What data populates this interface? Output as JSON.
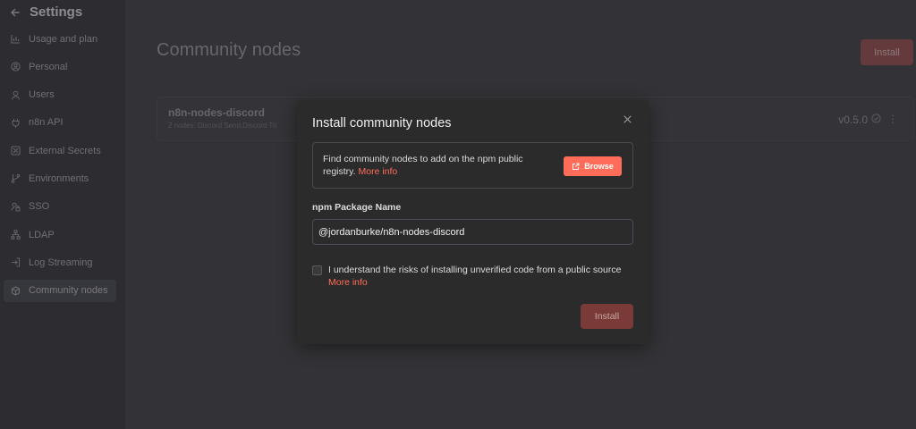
{
  "sidebar": {
    "title": "Settings",
    "items": [
      {
        "label": "Usage and plan",
        "icon": "chart-bar-icon"
      },
      {
        "label": "Personal",
        "icon": "user-circle-icon"
      },
      {
        "label": "Users",
        "icon": "user-icon"
      },
      {
        "label": "n8n API",
        "icon": "plug-icon"
      },
      {
        "label": "External Secrets",
        "icon": "vault-icon"
      },
      {
        "label": "Environments",
        "icon": "git-branch-icon"
      },
      {
        "label": "SSO",
        "icon": "user-lock-icon"
      },
      {
        "label": "LDAP",
        "icon": "network-icon"
      },
      {
        "label": "Log Streaming",
        "icon": "sign-in-icon"
      },
      {
        "label": "Community nodes",
        "icon": "cube-icon"
      }
    ]
  },
  "main": {
    "title": "Community nodes",
    "install_label": "Install",
    "node": {
      "name": "n8n-nodes-discord",
      "subtitle": "2 nodes: Discord Send,Discord Tri",
      "version": "v0.5.0"
    }
  },
  "modal": {
    "title": "Install community nodes",
    "info_text": "Find community nodes to add on the npm public registry.",
    "info_link": "More info",
    "browse_label": "Browse",
    "package_label": "npm Package Name",
    "package_value": "@jordanburke/n8n-nodes-discord",
    "agree_text": "I understand the risks of installing unverified code from a public source",
    "agree_link": "More info",
    "install_label": "Install"
  },
  "colors": {
    "accent": "#ff6d5a",
    "disabled_button": "#7a3a37",
    "background": "#2e2e2e",
    "modal_background": "#2b2b2b"
  }
}
